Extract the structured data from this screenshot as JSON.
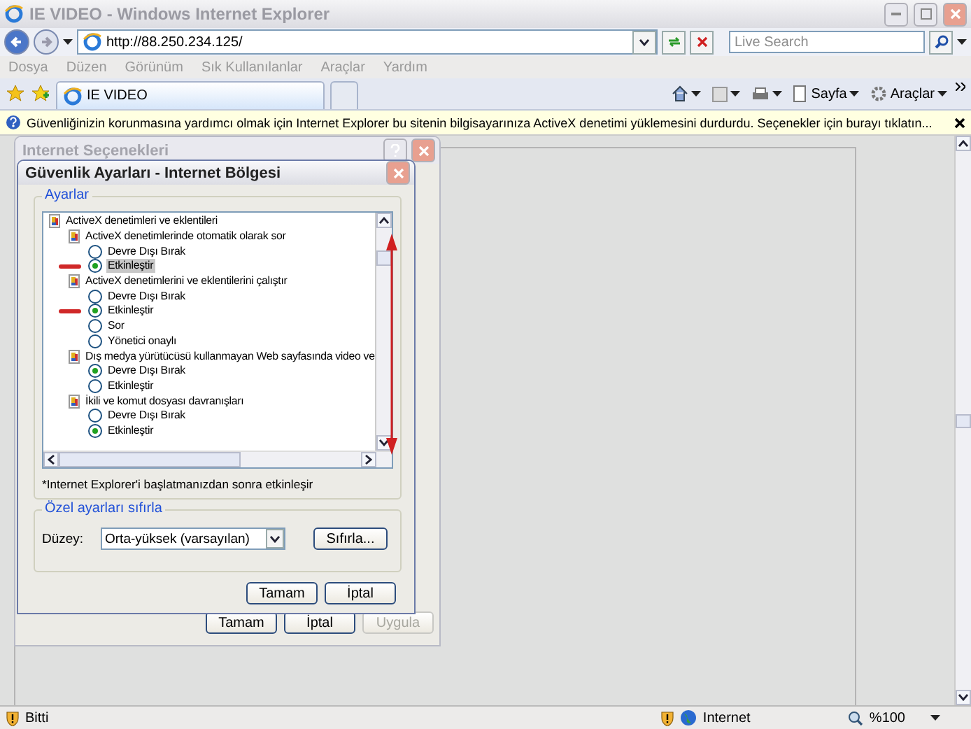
{
  "window": {
    "title": "IE VIDEO - Windows Internet Explorer"
  },
  "address_bar": {
    "url": "http://88.250.234.125/"
  },
  "search": {
    "placeholder": "Live Search"
  },
  "menu": [
    {
      "label": "Dosya",
      "disabled": true
    },
    {
      "label": "Düzen",
      "disabled": true
    },
    {
      "label": "Görünüm",
      "disabled": true
    },
    {
      "label": "Sık Kullanılanlar",
      "disabled": true
    },
    {
      "label": "Araçlar",
      "disabled": true
    },
    {
      "label": "Yardım",
      "disabled": true
    }
  ],
  "tabs": [
    {
      "label": "IE VIDEO",
      "selected": true
    }
  ],
  "command_bar": [
    {
      "label": "Sayfa"
    },
    {
      "label": "Araçlar"
    }
  ],
  "info_bar": {
    "message": "Güvenliğinizin korunmasına yardımcı olmak için Internet Explorer bu sitenin bilgisayarınıza ActiveX denetimi yüklemesini durdurdu. Seçenekler için burayı tıklatın..."
  },
  "options_dialog": {
    "title": "Internet Seçenekleri",
    "buttons": [
      {
        "label": "Tamam",
        "disabled": false
      },
      {
        "label": "İptal",
        "disabled": false
      },
      {
        "label": "Uygula",
        "disabled": true
      }
    ]
  },
  "security_dialog": {
    "title": "Güvenlik Ayarları - Internet Bölgesi",
    "settings_group": {
      "title": "Ayarlar",
      "note": "*Internet Explorer'i başlatmanızdan sonra etkinleşir",
      "tree": [
        {
          "label": "ActiveX denetimleri ve eklentileri",
          "children": [
            {
              "label": "ActiveX denetimlerinde otomatik olarak sor",
              "children": [
                {
                  "label": "Devre Dışı Bırak",
                  "checked": false,
                  "selected": false,
                  "marked": false
                },
                {
                  "label": "Etkinleştir",
                  "checked": true,
                  "selected": true,
                  "marked": true
                }
              ]
            },
            {
              "label": "ActiveX denetimlerini ve eklentilerini çalıştır",
              "children": [
                {
                  "label": "Devre Dışı Bırak",
                  "checked": false,
                  "selected": false,
                  "marked": false
                },
                {
                  "label": "Etkinleştir",
                  "checked": true,
                  "selected": false,
                  "marked": true
                },
                {
                  "label": "Sor",
                  "checked": false,
                  "selected": false,
                  "marked": false
                },
                {
                  "label": "Yönetici onaylı",
                  "checked": false,
                  "selected": false,
                  "marked": false
                }
              ]
            },
            {
              "label": "Dış medya yürütücüsü kullanmayan Web sayfasında video ve",
              "children": [
                {
                  "label": "Devre Dışı Bırak",
                  "checked": true,
                  "selected": false,
                  "marked": false
                },
                {
                  "label": "Etkinleştir",
                  "checked": false,
                  "selected": false,
                  "marked": false
                }
              ]
            },
            {
              "label": "İkili ve komut dosyası davranışları",
              "children": [
                {
                  "label": "Devre Dışı Bırak",
                  "checked": false,
                  "selected": false,
                  "marked": false
                },
                {
                  "label": "Etkinleştir",
                  "checked": true,
                  "selected": false,
                  "marked": false
                }
              ]
            }
          ]
        }
      ]
    },
    "reset_group": {
      "title": "Özel ayarları sıfırla",
      "level_label": "Düzey:",
      "level_value": "Orta-yüksek (varsayılan)",
      "reset_button": "Sıfırla..."
    },
    "buttons": [
      {
        "label": "Tamam"
      },
      {
        "label": "İptal"
      }
    ]
  },
  "status_bar": {
    "text": "Bitti",
    "zone": "Internet",
    "zoom": "%100"
  }
}
